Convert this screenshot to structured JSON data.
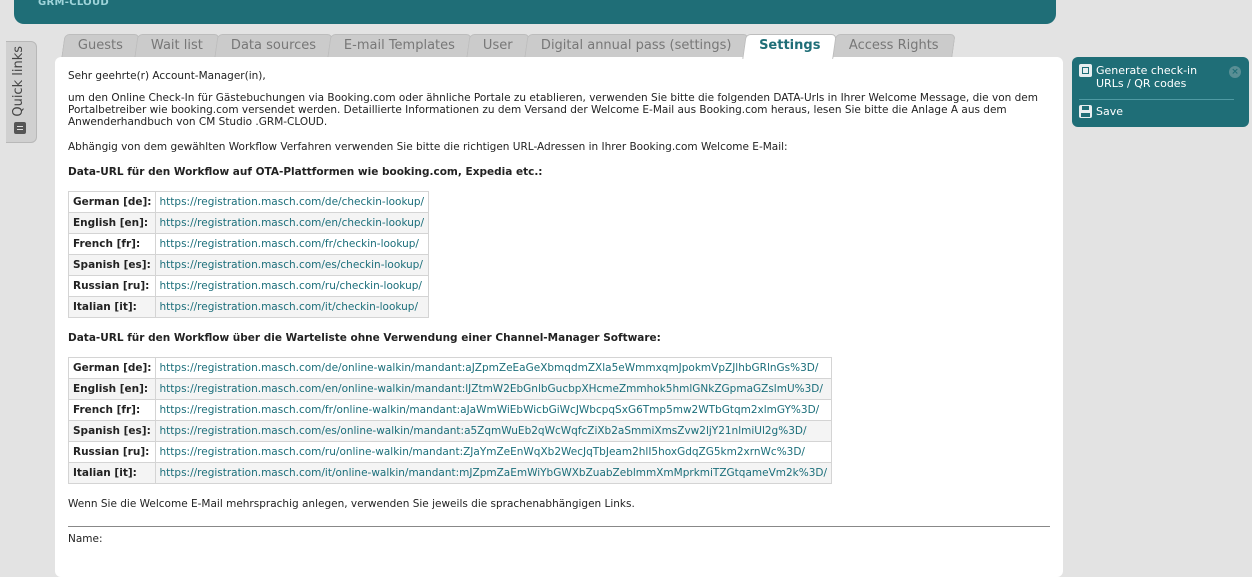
{
  "app": {
    "brand": "GRM-CLOUD"
  },
  "quick_links": {
    "label": "Quick links",
    "icon": "list-icon"
  },
  "tabs": [
    {
      "label": "Guests",
      "active": false
    },
    {
      "label": "Wait list",
      "active": false
    },
    {
      "label": "Data sources",
      "active": false
    },
    {
      "label": "E-mail Templates",
      "active": false
    },
    {
      "label": "User",
      "active": false
    },
    {
      "label": "Digital annual pass (settings)",
      "active": false
    },
    {
      "label": "Settings",
      "active": true
    },
    {
      "label": "Access Rights",
      "active": false
    }
  ],
  "content": {
    "greeting": "Sehr geehrte(r) Account-Manager(in),",
    "intro": "um den Online Check-In für Gästebuchungen via Booking.com oder ähnliche Portale zu etablieren, verwenden Sie bitte die folgenden DATA-Urls in Ihrer Welcome Message, die von dem Portalbetreiber wie booking.com versendet werden. Detaillierte Informationen zu dem Versand der Welcome E-Mail aus Booking.com heraus, lesen Sie bitte die Anlage A aus dem Anwenderhandbuch von CM Studio .GRM-CLOUD.",
    "workflow_note": "Abhängig von dem gewählten Workflow Verfahren verwenden Sie bitte die richtigen URL-Adressen in Ihrer Booking.com Welcome E-Mail:",
    "ota_heading": "Data-URL für den Workflow auf OTA-Plattformen wie booking.com, Expedia etc.:",
    "ota_rows": [
      {
        "lang": "German [de]:",
        "url": "https://registration.masch.com/de/checkin-lookup/"
      },
      {
        "lang": "English [en]:",
        "url": "https://registration.masch.com/en/checkin-lookup/"
      },
      {
        "lang": "French [fr]:",
        "url": "https://registration.masch.com/fr/checkin-lookup/"
      },
      {
        "lang": "Spanish [es]:",
        "url": "https://registration.masch.com/es/checkin-lookup/"
      },
      {
        "lang": "Russian [ru]:",
        "url": "https://registration.masch.com/ru/checkin-lookup/"
      },
      {
        "lang": "Italian [it]:",
        "url": "https://registration.masch.com/it/checkin-lookup/"
      }
    ],
    "waitlist_heading": "Data-URL für den Workflow über die Warteliste ohne Verwendung einer Channel-Manager Software:",
    "waitlist_rows": [
      {
        "lang": "German [de]:",
        "url": "https://registration.masch.com/de/online-walkin/mandant:aJZpmZeEaGeXbmqdmZXla5eWmmxqmJpokmVpZJlhbGRlnGs%3D/"
      },
      {
        "lang": "English [en]:",
        "url": "https://registration.masch.com/en/online-walkin/mandant:lJZtmW2EbGnlbGucbpXHcmeZmmhok5hmlGNkZGpmaGZslmU%3D/"
      },
      {
        "lang": "French [fr]:",
        "url": "https://registration.masch.com/fr/online-walkin/mandant:aJaWmWiEbWicbGiWcJWbcpqSxG6Tmp5mw2WTbGtqm2xlmGY%3D/"
      },
      {
        "lang": "Spanish [es]:",
        "url": "https://registration.masch.com/es/online-walkin/mandant:a5ZqmWuEb2qWcWqfcZiXb2aSmmiXmsZvw2ljY21nlmiUl2g%3D/"
      },
      {
        "lang": "Russian [ru]:",
        "url": "https://registration.masch.com/ru/online-walkin/mandant:ZJaYmZeEnWqXb2WecJqTbJeam2hlI5hoxGdqZG5km2xrnWc%3D/"
      },
      {
        "lang": "Italian [it]:",
        "url": "https://registration.masch.com/it/online-walkin/mandant:mJZpmZaEmWiYbGWXbZuabZeblmmXmMprkmiTZGtqameVm2k%3D/"
      }
    ],
    "multilang_note": "Wenn Sie die Welcome E-Mail mehrsprachig anlegen, verwenden Sie jeweils die sprachenabhängigen Links.",
    "name_label": "Name:"
  },
  "sidebar": {
    "generate_label": "Generate check-in URLs / QR codes",
    "save_label": "Save",
    "close_glyph": "×"
  }
}
